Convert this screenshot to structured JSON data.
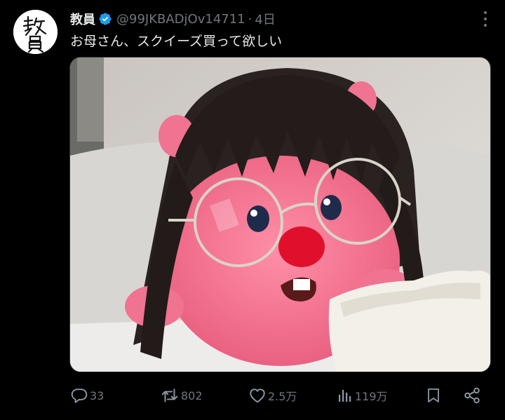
{
  "tweet": {
    "display_name": "教員",
    "handle": "@99JKBADjOv14711",
    "separator": "·",
    "time": "4日",
    "text": "お母さん、スクイーズ買って欲しい",
    "verified_color": "#1d9bf0"
  },
  "actions": {
    "replies": "33",
    "retweets": "802",
    "likes": "2.5万",
    "views": "119万"
  },
  "icons": [
    "avatar",
    "verified-badge-icon",
    "more-icon",
    "reply-icon",
    "retweet-icon",
    "like-icon",
    "views-icon",
    "bookmark-icon",
    "share-icon"
  ],
  "colors": {
    "background": "#000000",
    "text": "#e7e9ea",
    "secondary": "#71767b"
  }
}
